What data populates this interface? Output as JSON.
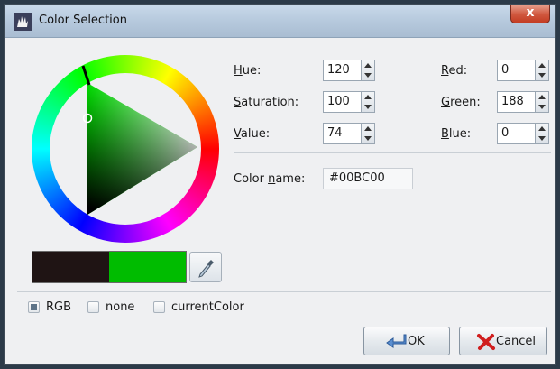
{
  "window": {
    "title": "Color Selection",
    "close_label": "x"
  },
  "fields": {
    "hue": {
      "label_u": "H",
      "label_rest": "ue:",
      "value": "120"
    },
    "saturation": {
      "label_u": "S",
      "label_rest": "aturation:",
      "value": "100"
    },
    "value": {
      "label_u": "V",
      "label_rest": "alue:",
      "value": "74"
    },
    "red": {
      "label_u": "R",
      "label_rest": "ed:",
      "value": "0"
    },
    "green": {
      "label_u": "G",
      "label_rest": "reen:",
      "value": "188"
    },
    "blue": {
      "label_u": "B",
      "label_rest": "lue:",
      "value": "0"
    }
  },
  "color_name": {
    "label_pre": "Color ",
    "label_u": "n",
    "label_rest": "ame:",
    "value": "#00BC00"
  },
  "preview": {
    "old_color": "#1f1414",
    "new_color": "#00bc00"
  },
  "options": [
    {
      "label": "RGB",
      "checked": true
    },
    {
      "label": "none",
      "checked": false
    },
    {
      "label": "currentColor",
      "checked": false
    }
  ],
  "buttons": {
    "ok": {
      "label_u": "O",
      "label_rest": "K"
    },
    "cancel": {
      "label_u": "C",
      "label_rest": "ancel"
    }
  },
  "icons": {
    "app": "paint-hand-icon",
    "picker": "eyedropper-icon",
    "ok": "arrow-enter-icon",
    "cancel": "red-x-icon"
  }
}
